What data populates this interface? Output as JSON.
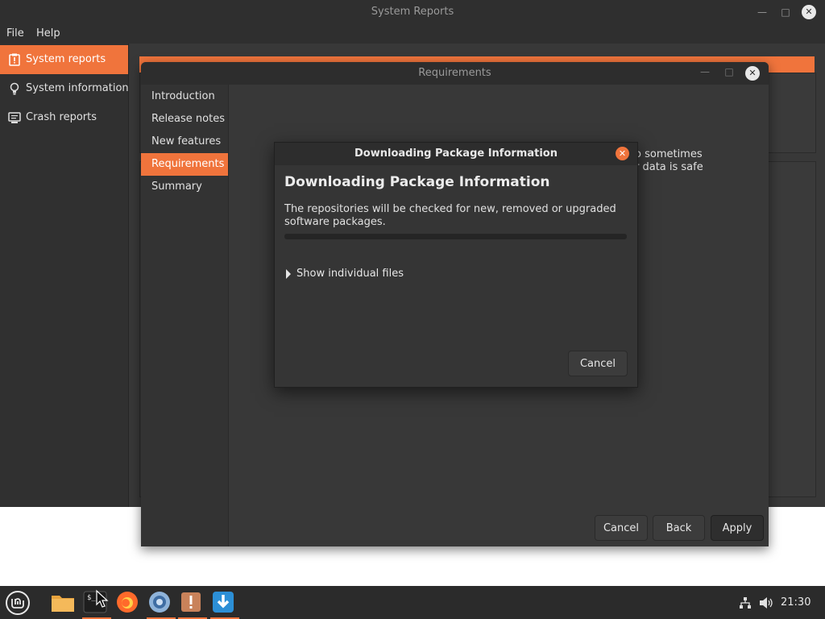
{
  "main_window": {
    "title": "System Reports",
    "menu": [
      "File",
      "Help"
    ],
    "sidebar": [
      {
        "label": "System reports",
        "icon": "report-icon",
        "active": true
      },
      {
        "label": "System information",
        "icon": "lightbulb-icon",
        "active": false
      },
      {
        "label": "Crash reports",
        "icon": "monitor-icon",
        "active": false
      }
    ]
  },
  "requirements_window": {
    "title": "Requirements",
    "nav": [
      {
        "label": "Introduction",
        "active": false
      },
      {
        "label": "Release notes",
        "active": false
      },
      {
        "label": "New features",
        "active": false
      },
      {
        "label": "Requirements",
        "active": true
      },
      {
        "label": "Summary",
        "active": false
      }
    ],
    "partial_text_line1": "o sometimes",
    "partial_text_line2": "r data is safe",
    "buttons": {
      "cancel": "Cancel",
      "back": "Back",
      "apply": "Apply"
    }
  },
  "download_dialog": {
    "title": "Downloading Package Information",
    "heading": "Downloading Package Information",
    "description": "The repositories will be checked for new, removed or upgraded software packages.",
    "progress": 0,
    "expander_label": "Show individual files",
    "cancel_label": "Cancel"
  },
  "taskbar": {
    "apps": [
      "files-icon",
      "terminal-icon",
      "firefox-icon",
      "browser-icon",
      "system-reports-icon",
      "update-manager-icon"
    ],
    "clock": "21:30"
  },
  "colors": {
    "accent": "#f0743c",
    "window_bg": "#383838"
  }
}
